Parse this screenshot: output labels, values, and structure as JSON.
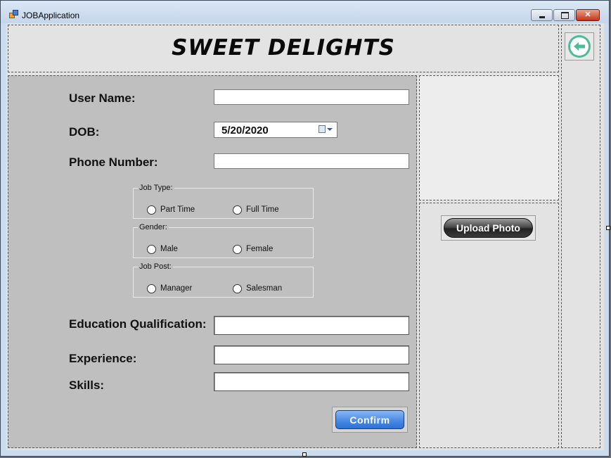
{
  "window": {
    "title": "JOBApplication",
    "controls": {
      "minimize": "minimize-icon",
      "maximize": "maximize-icon",
      "close": "✕"
    }
  },
  "header": {
    "brand": "SWEET DELIGHTS",
    "back_icon": "arrow-left-icon"
  },
  "form": {
    "username_label": "User Name:",
    "username_value": "",
    "dob_label": "DOB:",
    "dob_value": "5/20/2020",
    "phone_label": "Phone Number:",
    "phone_value": "",
    "job_type": {
      "title": "Job Type:",
      "options": [
        "Part Time",
        "Full Time"
      ]
    },
    "gender": {
      "title": "Gender:",
      "options": [
        "Male",
        "Female"
      ]
    },
    "job_post": {
      "title": "Job Post:",
      "options": [
        "Manager",
        "Salesman"
      ]
    },
    "education_label": "Education Qualification:",
    "education_value": "",
    "experience_label": "Experience:",
    "experience_value": "",
    "skills_label": "Skills:",
    "skills_value": "",
    "confirm_label": "Confirm"
  },
  "photo": {
    "upload_label": "Upload Photo"
  },
  "colors": {
    "form_background": "#bfbfbf",
    "back_button": "#4cbc97",
    "confirm_button": "#4b8be6",
    "upload_button": "#333333"
  }
}
